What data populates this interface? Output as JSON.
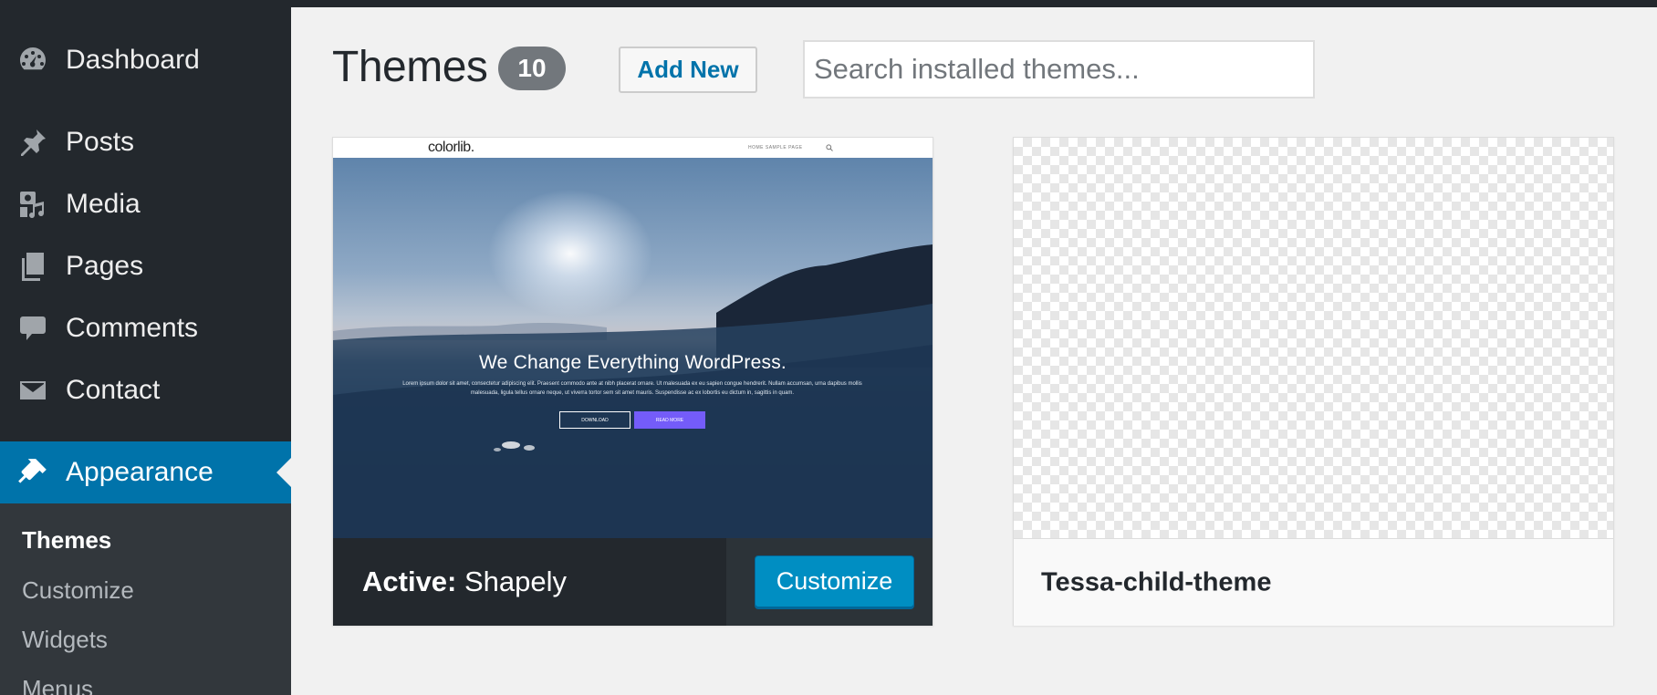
{
  "sidebar": {
    "items": [
      {
        "label": "Dashboard",
        "icon": "dashboard-icon"
      },
      {
        "label": "Posts",
        "icon": "pin-icon"
      },
      {
        "label": "Media",
        "icon": "media-icon"
      },
      {
        "label": "Pages",
        "icon": "pages-icon"
      },
      {
        "label": "Comments",
        "icon": "comment-icon"
      },
      {
        "label": "Contact",
        "icon": "envelope-icon"
      },
      {
        "label": "Appearance",
        "icon": "brush-icon",
        "current": true
      }
    ],
    "submenu": [
      {
        "label": "Themes",
        "current": true
      },
      {
        "label": "Customize"
      },
      {
        "label": "Widgets"
      },
      {
        "label": "Menus"
      }
    ]
  },
  "header": {
    "title": "Themes",
    "count": "10",
    "add_new_label": "Add New",
    "search_placeholder": "Search installed themes..."
  },
  "themes": [
    {
      "active_prefix": "Active:",
      "name": "Shapely",
      "action_label": "Customize",
      "preview": {
        "logo": "colorlib.",
        "nav_links": "HOME      SAMPLE PAGE",
        "headline": "We Change Everything WordPress.",
        "subtext": "Lorem ipsum dolor sit amet, consectetur adipiscing elit. Praesent commodo ante at nibh placerat ornare. Ut malesuada ex eu sapien congue hendrerit. Nullam accumsan, urna dapibus mollis malesuada, ligula tellus ornare neque, ut viverra tortor sem sit amet mauris. Suspendisse ac ex lobortis eu dictum in, sagittis in quam.",
        "button_1": "DOWNLOAD",
        "button_2": "READ MORE"
      }
    },
    {
      "name": "Tessa-child-theme"
    }
  ],
  "colors": {
    "admin_bar": "#23282d",
    "accent": "#0073aa",
    "button_primary": "#008ec2"
  }
}
